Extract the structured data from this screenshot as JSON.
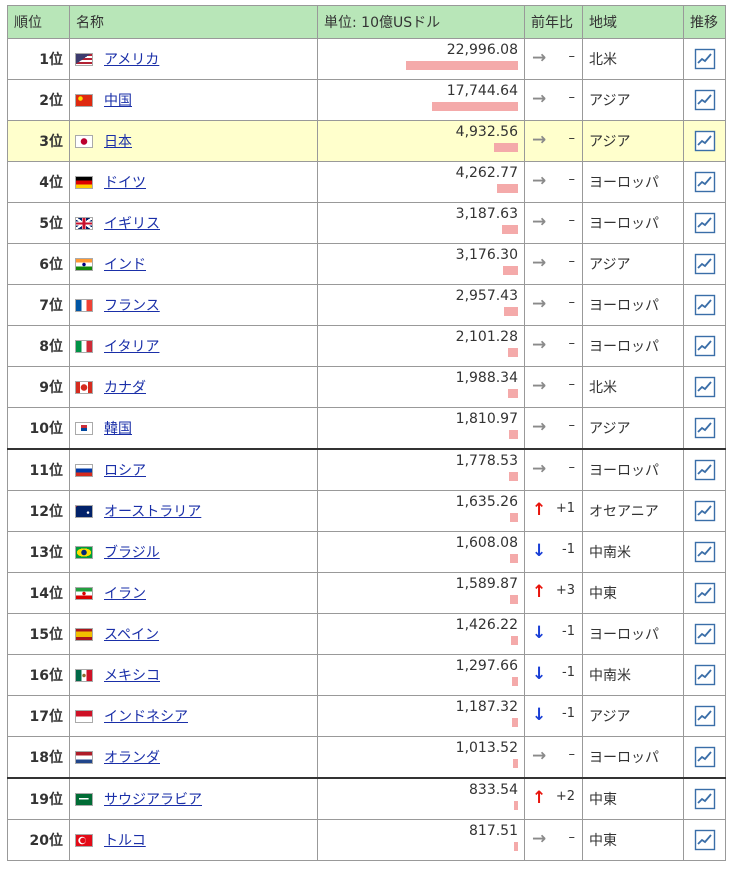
{
  "columns": {
    "rank": "順位",
    "name": "名称",
    "unit": "単位: 10億USドル",
    "change": "前年比",
    "region": "地域",
    "trend": "推移"
  },
  "colors": {
    "header_bg": "#b8e6b8",
    "highlight_row": "#ffffcc",
    "bar": "#f4aaaa",
    "up_arrow": "#e8140c",
    "down_arrow": "#1a3fd6",
    "same_arrow": "#8a8a8a",
    "link": "#1a2fa8"
  },
  "bar_scale_max": 22996.08,
  "rows": [
    {
      "rank": "1位",
      "country": "アメリカ",
      "flag": "us-flag-icon",
      "value": "22,996.08",
      "num": 22996.08,
      "dir": "same",
      "arrow": "→",
      "change": "–",
      "region": "北米"
    },
    {
      "rank": "2位",
      "country": "中国",
      "flag": "cn-flag-icon",
      "value": "17,744.64",
      "num": 17744.64,
      "dir": "same",
      "arrow": "→",
      "change": "–",
      "region": "アジア"
    },
    {
      "rank": "3位",
      "country": "日本",
      "flag": "jp-flag-icon",
      "value": "4,932.56",
      "num": 4932.56,
      "dir": "same",
      "arrow": "→",
      "change": "–",
      "region": "アジア"
    },
    {
      "rank": "4位",
      "country": "ドイツ",
      "flag": "de-flag-icon",
      "value": "4,262.77",
      "num": 4262.77,
      "dir": "same",
      "arrow": "→",
      "change": "–",
      "region": "ヨーロッパ"
    },
    {
      "rank": "5位",
      "country": "イギリス",
      "flag": "gb-flag-icon",
      "value": "3,187.63",
      "num": 3187.63,
      "dir": "same",
      "arrow": "→",
      "change": "–",
      "region": "ヨーロッパ"
    },
    {
      "rank": "6位",
      "country": "インド",
      "flag": "in-flag-icon",
      "value": "3,176.30",
      "num": 3176.3,
      "dir": "same",
      "arrow": "→",
      "change": "–",
      "region": "アジア"
    },
    {
      "rank": "7位",
      "country": "フランス",
      "flag": "fr-flag-icon",
      "value": "2,957.43",
      "num": 2957.43,
      "dir": "same",
      "arrow": "→",
      "change": "–",
      "region": "ヨーロッパ"
    },
    {
      "rank": "8位",
      "country": "イタリア",
      "flag": "it-flag-icon",
      "value": "2,101.28",
      "num": 2101.28,
      "dir": "same",
      "arrow": "→",
      "change": "–",
      "region": "ヨーロッパ"
    },
    {
      "rank": "9位",
      "country": "カナダ",
      "flag": "ca-flag-icon",
      "value": "1,988.34",
      "num": 1988.34,
      "dir": "same",
      "arrow": "→",
      "change": "–",
      "region": "北米"
    },
    {
      "rank": "10位",
      "country": "韓国",
      "flag": "kr-flag-icon",
      "value": "1,810.97",
      "num": 1810.97,
      "dir": "same",
      "arrow": "→",
      "change": "–",
      "region": "アジア"
    },
    {
      "rank": "11位",
      "country": "ロシア",
      "flag": "ru-flag-icon",
      "value": "1,778.53",
      "num": 1778.53,
      "dir": "same",
      "arrow": "→",
      "change": "–",
      "region": "ヨーロッパ"
    },
    {
      "rank": "12位",
      "country": "オーストラリア",
      "flag": "au-flag-icon",
      "value": "1,635.26",
      "num": 1635.26,
      "dir": "up",
      "arrow": "↑",
      "change": "+1",
      "region": "オセアニア"
    },
    {
      "rank": "13位",
      "country": "ブラジル",
      "flag": "br-flag-icon",
      "value": "1,608.08",
      "num": 1608.08,
      "dir": "down",
      "arrow": "↓",
      "change": "-1",
      "region": "中南米"
    },
    {
      "rank": "14位",
      "country": "イラン",
      "flag": "ir-flag-icon",
      "value": "1,589.87",
      "num": 1589.87,
      "dir": "up",
      "arrow": "↑",
      "change": "+3",
      "region": "中東"
    },
    {
      "rank": "15位",
      "country": "スペイン",
      "flag": "es-flag-icon",
      "value": "1,426.22",
      "num": 1426.22,
      "dir": "down",
      "arrow": "↓",
      "change": "-1",
      "region": "ヨーロッパ"
    },
    {
      "rank": "16位",
      "country": "メキシコ",
      "flag": "mx-flag-icon",
      "value": "1,297.66",
      "num": 1297.66,
      "dir": "down",
      "arrow": "↓",
      "change": "-1",
      "region": "中南米"
    },
    {
      "rank": "17位",
      "country": "インドネシア",
      "flag": "id-flag-icon",
      "value": "1,187.32",
      "num": 1187.32,
      "dir": "down",
      "arrow": "↓",
      "change": "-1",
      "region": "アジア"
    },
    {
      "rank": "18位",
      "country": "オランダ",
      "flag": "nl-flag-icon",
      "value": "1,013.52",
      "num": 1013.52,
      "dir": "same",
      "arrow": "→",
      "change": "–",
      "region": "ヨーロッパ"
    },
    {
      "rank": "19位",
      "country": "サウジアラビア",
      "flag": "sa-flag-icon",
      "value": "833.54",
      "num": 833.54,
      "dir": "up",
      "arrow": "↑",
      "change": "+2",
      "region": "中東"
    },
    {
      "rank": "20位",
      "country": "トルコ",
      "flag": "tr-flag-icon",
      "value": "817.51",
      "num": 817.51,
      "dir": "same",
      "arrow": "→",
      "change": "–",
      "region": "中東"
    }
  ]
}
